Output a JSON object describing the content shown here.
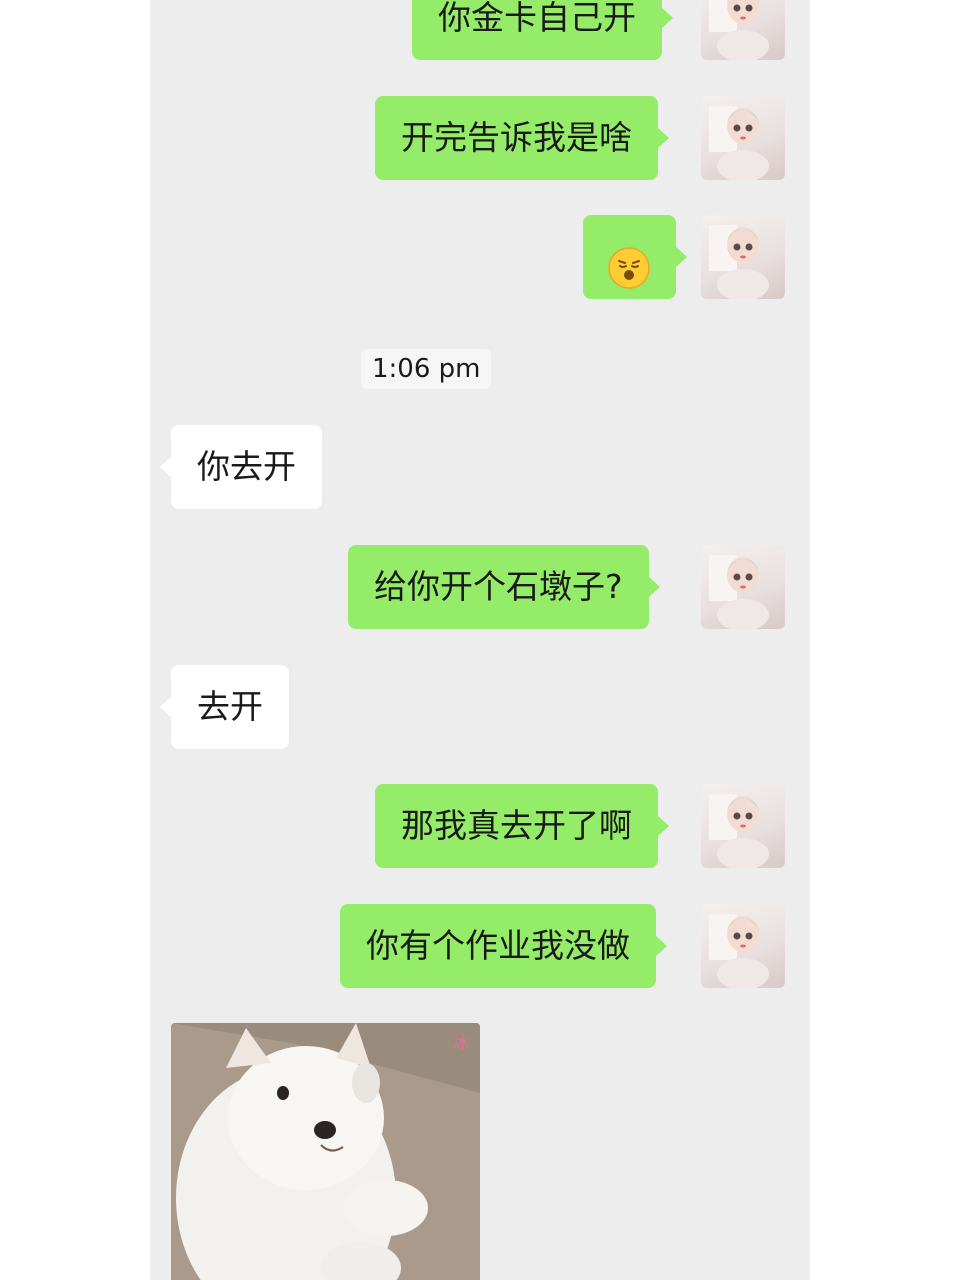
{
  "conversation": {
    "messages": [
      {
        "side": "out",
        "text": "你金卡自己开"
      },
      {
        "side": "out",
        "text": "开完告诉我是啥"
      },
      {
        "side": "out",
        "emoji": "hushed-face-emoji"
      },
      {
        "side": "in",
        "text": "你去开"
      },
      {
        "side": "out",
        "text": "给你开个石墩子?"
      },
      {
        "side": "in",
        "text": "去开"
      },
      {
        "side": "out",
        "text": "那我真去开了啊"
      },
      {
        "side": "out",
        "text": "你有个作业我没做"
      },
      {
        "side": "in",
        "image": "white-dog-sticker"
      }
    ],
    "timestamp": "1:06 pm",
    "sticker_watermark": "冰"
  },
  "colors": {
    "outgoing_bubble": "#95ec69",
    "incoming_bubble": "#ffffff",
    "chat_background": "#ededed"
  }
}
